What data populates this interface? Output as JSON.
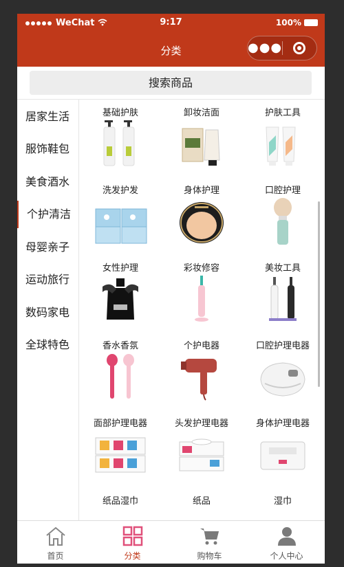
{
  "status_bar": {
    "carrier": "WeChat",
    "time": "9:17",
    "battery": "100%"
  },
  "nav": {
    "title": "分类",
    "more_icon": "more-dots-icon",
    "close_icon": "target-icon"
  },
  "search": {
    "label": "搜索商品"
  },
  "categories": [
    {
      "label": "居家生活"
    },
    {
      "label": "服饰鞋包"
    },
    {
      "label": "美食酒水"
    },
    {
      "label": "个护清洁",
      "active": true
    },
    {
      "label": "母婴亲子"
    },
    {
      "label": "运动旅行"
    },
    {
      "label": "数码家电"
    },
    {
      "label": "全球特色"
    }
  ],
  "subcategories": [
    {
      "label": "基础护肤",
      "icon": "pump-bottles-icon"
    },
    {
      "label": "卸妆洁面",
      "icon": "cleanser-box-icon"
    },
    {
      "label": "护肤工具",
      "icon": "tubes-icon"
    },
    {
      "label": "洗发护发",
      "icon": "blue-boxes-icon"
    },
    {
      "label": "身体护理",
      "icon": "cushion-compact-icon"
    },
    {
      "label": "口腔护理",
      "icon": "brush-icon"
    },
    {
      "label": "女性护理",
      "icon": "perfume-bottle-icon"
    },
    {
      "label": "彩妆修容",
      "icon": "pink-toothbrush-icon"
    },
    {
      "label": "美妆工具",
      "icon": "toothbrush-pair-icon"
    },
    {
      "label": "香水香氛",
      "icon": "face-brushes-icon"
    },
    {
      "label": "个护电器",
      "icon": "hair-dryer-icon"
    },
    {
      "label": "口腔护理电器",
      "icon": "massager-icon"
    },
    {
      "label": "面部护理电器",
      "icon": "tissue-packs-icon"
    },
    {
      "label": "头发护理电器",
      "icon": "tissue-boxes-icon"
    },
    {
      "label": "身体护理电器",
      "icon": "wipes-pack-icon"
    },
    {
      "label": "纸品湿巾",
      "icon": "bottle-icon"
    },
    {
      "label": "纸品",
      "icon": "bottle-icon"
    },
    {
      "label": "湿巾",
      "icon": "bottle-icon"
    }
  ],
  "tabbar": [
    {
      "label": "首页",
      "icon": "home-icon"
    },
    {
      "label": "分类",
      "icon": "category-grid-icon",
      "active": true
    },
    {
      "label": "购物车",
      "icon": "cart-icon"
    },
    {
      "label": "个人中心",
      "icon": "user-icon"
    }
  ],
  "colors": {
    "brand": "#c0391a",
    "tab_active": "#e0507a",
    "tab_inactive": "#888888"
  }
}
